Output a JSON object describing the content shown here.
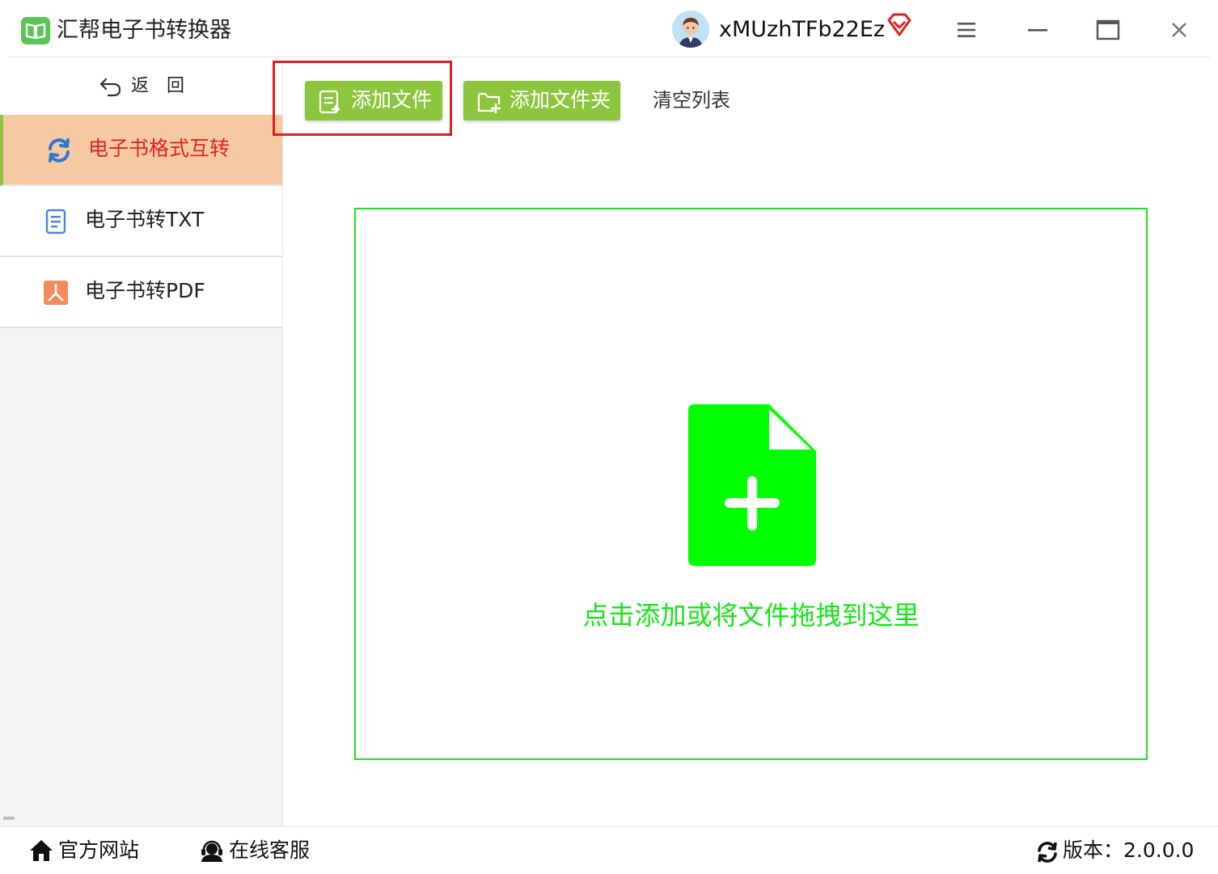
{
  "app": {
    "title": "汇帮电子书转换器",
    "username": "xMUzhTFb22Ez"
  },
  "sidebar": {
    "back_label": "返回",
    "items": [
      {
        "label": "电子书格式互转",
        "active": true
      },
      {
        "label": "电子书转TXT",
        "active": false
      },
      {
        "label": "电子书转PDF",
        "active": false
      }
    ]
  },
  "toolbar": {
    "add_file_label": "添加文件",
    "add_folder_label": "添加文件夹",
    "clear_list_label": "清空列表"
  },
  "dropzone": {
    "hint": "点击添加或将文件拖拽到这里"
  },
  "footer": {
    "website_label": "官方网站",
    "support_label": "在线客服",
    "version_text": "版本：2.0.0.0"
  },
  "colors": {
    "accent_green": "#8cc63f",
    "drop_green": "#00ff00",
    "active_item_bg": "#f7c9a2",
    "active_item_text": "#e0261b",
    "highlight_red": "#e02020"
  },
  "icons": {
    "app_logo": "book-icon",
    "vip": "diamond-icon",
    "menu": "hamburger-icon",
    "minimize": "minimize-icon",
    "maximize": "maximize-icon",
    "close": "close-icon",
    "back": "undo-arrow-icon",
    "nav_convert": "refresh-icon",
    "nav_txt": "document-icon",
    "nav_pdf": "pdf-icon",
    "add_file": "file-add-icon",
    "add_folder": "folder-add-icon",
    "drop": "file-plus-icon",
    "website": "home-icon",
    "support": "headset-icon",
    "version": "refresh-icon"
  }
}
